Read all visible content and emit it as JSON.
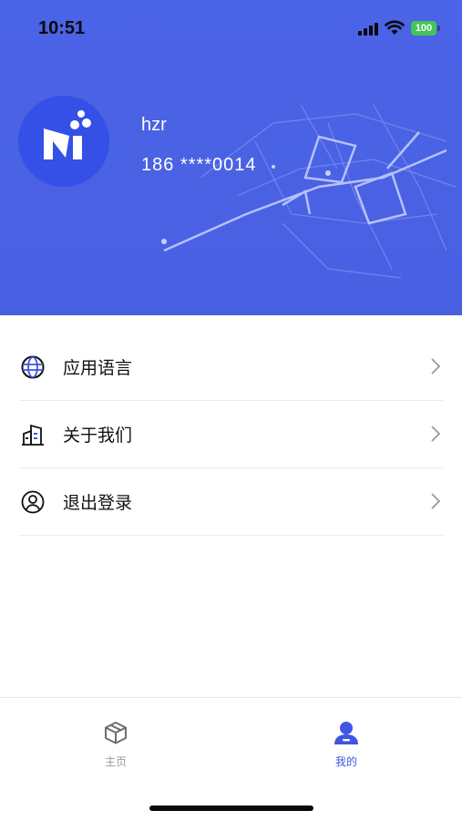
{
  "status_bar": {
    "time": "10:51",
    "battery": "100"
  },
  "profile": {
    "username": "hzr",
    "phone": "186 ****0014"
  },
  "menu": {
    "items": [
      {
        "label": "应用语言",
        "icon": "globe-icon"
      },
      {
        "label": "关于我们",
        "icon": "building-icon"
      },
      {
        "label": "退出登录",
        "icon": "user-circle-icon"
      }
    ]
  },
  "tabbar": {
    "tabs": [
      {
        "label": "主页",
        "icon": "cube-icon",
        "active": false
      },
      {
        "label": "我的",
        "icon": "person-icon",
        "active": true
      }
    ]
  },
  "colors": {
    "accent": "#3f55e3",
    "header": "#4b63e6",
    "battery": "#43c35a"
  }
}
